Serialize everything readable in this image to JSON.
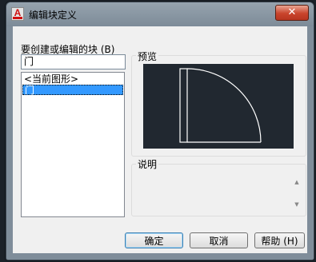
{
  "window": {
    "title": "编辑块定义",
    "close_glyph": "✕"
  },
  "left": {
    "label": "要创建或编辑的块 (B)",
    "name_value": "门",
    "list_items": [
      "<当前图形>",
      "门"
    ]
  },
  "preview": {
    "title": "预览"
  },
  "description": {
    "title": "说明",
    "text": ""
  },
  "buttons": {
    "ok": "确定",
    "cancel": "取消",
    "help": "帮助 (H)"
  },
  "colors": {
    "preview_bg": "#212830",
    "selection": "#3399ff",
    "door": "#ffffff"
  },
  "icons": [
    "autocad-icon",
    "close-icon",
    "scroll-up-icon",
    "scroll-down-icon"
  ]
}
